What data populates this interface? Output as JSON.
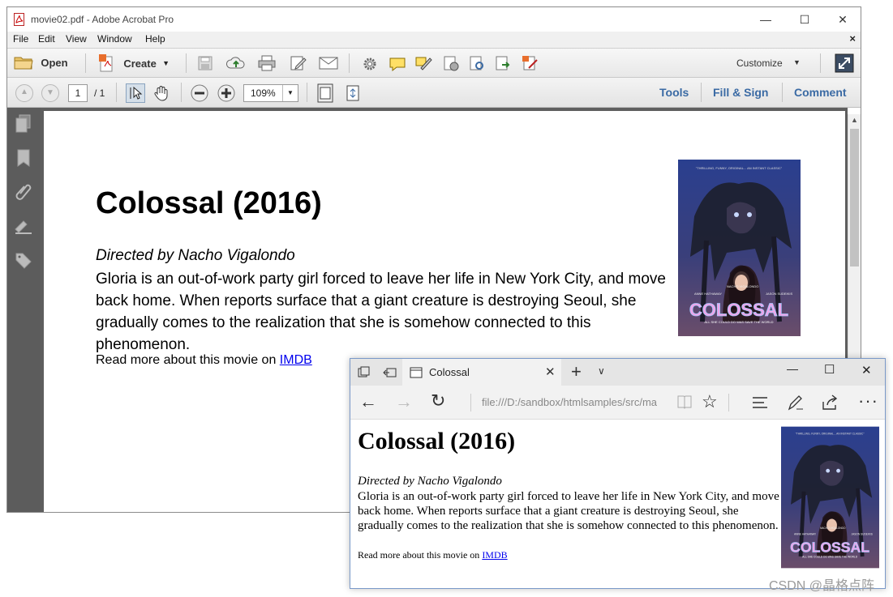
{
  "acrobat": {
    "title": "movie02.pdf - Adobe Acrobat Pro",
    "menu": [
      "File",
      "Edit",
      "View",
      "Window",
      "Help"
    ],
    "menu_close": "×",
    "toolbar": {
      "open": "Open",
      "create": "Create",
      "customize": "Customize"
    },
    "nav": {
      "page_current": "1",
      "page_total": "/ 1",
      "zoom": "109%"
    },
    "panels": {
      "tools": "Tools",
      "fill_sign": "Fill & Sign",
      "comment": "Comment"
    },
    "document": {
      "heading": "Colossal (2016)",
      "director": "Directed by Nacho Vigalondo",
      "description": "Gloria is an out-of-work party girl forced to leave her life in New York City, and move back home. When reports surface that a giant creature is destroying Seoul, she gradually comes to the realization that she is somehow connected to this phenomenon.",
      "read_more_prefix": "Read more about this movie on ",
      "read_more_link": "IMDB"
    }
  },
  "edge": {
    "tab_title": "Colossal",
    "url": "file:///D:/sandbox/htmlsamples/src/ma",
    "document": {
      "heading": "Colossal (2016)",
      "director": "Directed by Nacho Vigalondo",
      "description": "Gloria is an out-of-work party girl forced to leave her life in New York City, and move back home. When reports surface that a giant creature is destroying Seoul, she gradually comes to the realization that she is somehow connected to this phenomenon.",
      "read_more_prefix": "Read more about this movie on ",
      "read_more_link": "IMDB"
    }
  },
  "poster": {
    "top_quote": "\"THRILLING, FUNNY, ORIGINAL... AN INSTANT CLASSIC\"",
    "actors": [
      "ANNE HATHAWAY",
      "NACHO VIGALONDO",
      "JASON SUDEIKIS"
    ],
    "title": "COLOSSAL",
    "tagline": "ALL SHE COULD DO WAS SAVE THE WORLD"
  },
  "watermark": "CSDN @晶格点阵",
  "colors": {
    "link": "#0000ee",
    "panel_link": "#3a6aa4",
    "edge_border": "#7a99c9"
  }
}
